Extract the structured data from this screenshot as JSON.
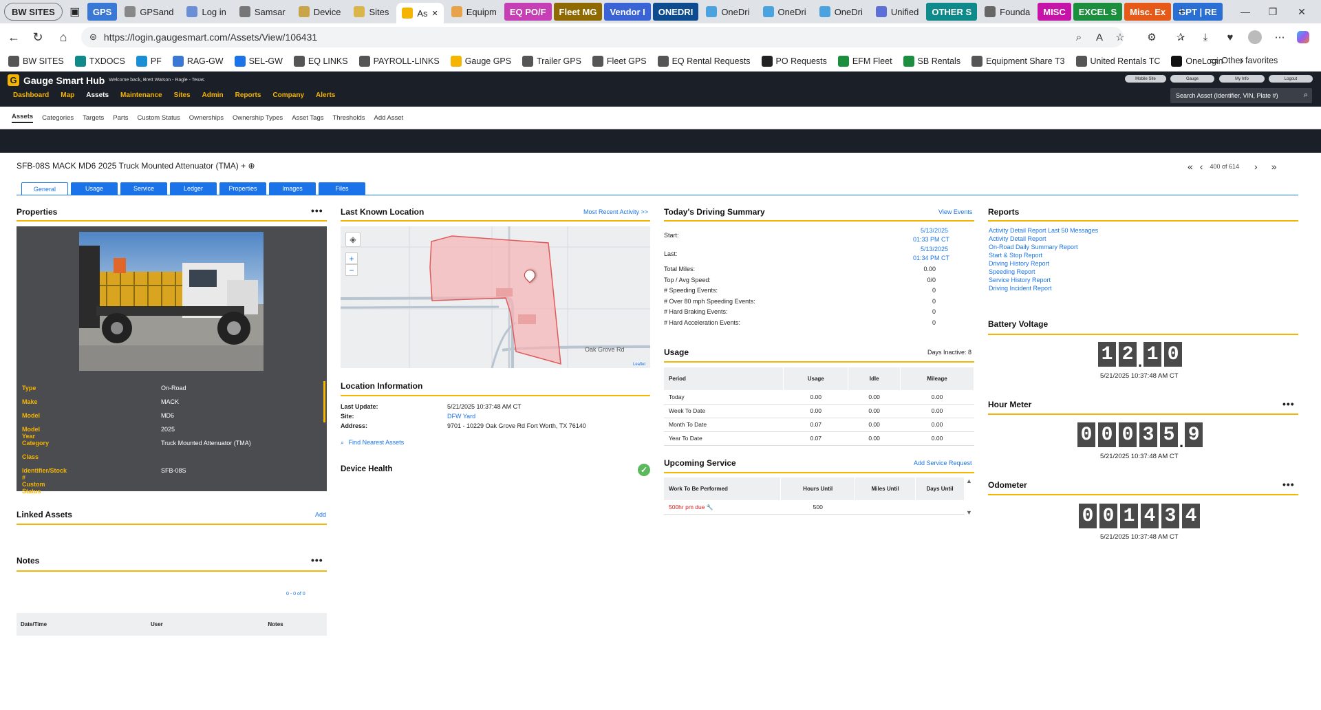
{
  "browser": {
    "tabs": [
      {
        "label": "BW SITES",
        "kind": "first",
        "color": ""
      },
      {
        "label": "GPS",
        "kind": "colored",
        "color": "#3a78d6"
      },
      {
        "label": "GPSand",
        "kind": "normal",
        "color": ""
      },
      {
        "label": "Log in",
        "kind": "normal",
        "color": ""
      },
      {
        "label": "Samsar",
        "kind": "normal",
        "color": ""
      },
      {
        "label": "Device",
        "kind": "normal",
        "color": ""
      },
      {
        "label": "Sites",
        "kind": "normal",
        "color": ""
      },
      {
        "label": "As",
        "kind": "active",
        "color": ""
      },
      {
        "label": "Equipm",
        "kind": "normal",
        "color": ""
      },
      {
        "label": "EQ PO/F",
        "kind": "colored",
        "color": "#c63fb4"
      },
      {
        "label": "Fleet MG",
        "kind": "colored",
        "color": "#8f6a00"
      },
      {
        "label": "Vendor I",
        "kind": "colored",
        "color": "#3a64d6"
      },
      {
        "label": "ONEDRI",
        "kind": "colored",
        "color": "#0d4c8f"
      },
      {
        "label": "OneDri",
        "kind": "normal",
        "color": ""
      },
      {
        "label": "OneDri",
        "kind": "normal",
        "color": ""
      },
      {
        "label": "OneDri",
        "kind": "normal",
        "color": ""
      },
      {
        "label": "Unified",
        "kind": "normal",
        "color": ""
      },
      {
        "label": "OTHER S",
        "kind": "colored",
        "color": "#0f8a8a"
      },
      {
        "label": "Founda",
        "kind": "normal",
        "color": ""
      },
      {
        "label": "MISC",
        "kind": "colored",
        "color": "#c614a8"
      },
      {
        "label": "EXCEL S",
        "kind": "colored",
        "color": "#1b8f3d"
      },
      {
        "label": "Misc. Ex",
        "kind": "colored",
        "color": "#e55a18"
      },
      {
        "label": "GPT | RE",
        "kind": "colored",
        "color": "#2a6fd4"
      }
    ],
    "url": "https://login.gaugesmart.com/Assets/View/106431",
    "bookmarks": [
      "BW SITES",
      "TXDOCS",
      "PF",
      "RAG-GW",
      "SEL-GW",
      "EQ LINKS",
      "PAYROLL-LINKS",
      "Gauge GPS",
      "Trailer GPS",
      "Fleet GPS",
      "EQ Rental Requests",
      "PO Requests",
      "EFM Fleet",
      "SB Rentals",
      "Equipment Share T3",
      "United Rentals TC",
      "OneLogin"
    ],
    "other_favorites": "Other favorites"
  },
  "app": {
    "brand": "Gauge Smart Hub",
    "welcome": "Welcome back, Brett Watson - Ragle - Texas",
    "nav": [
      "Dashboard",
      "Map",
      "Assets",
      "Maintenance",
      "Sites",
      "Admin",
      "Reports",
      "Company",
      "Alerts"
    ],
    "header_buttons": [
      "Mobile Site",
      "Gauge",
      "My Info",
      "Logout"
    ],
    "search_placeholder": "Search Asset (Identifier, VIN, Plate #)",
    "subnav": [
      "Assets",
      "Categories",
      "Targets",
      "Parts",
      "Custom Status",
      "Ownerships",
      "Ownership Types",
      "Asset Tags",
      "Thresholds",
      "Add Asset"
    ]
  },
  "asset": {
    "title": "SFB-08S MACK MD6 2025 Truck Mounted Attenuator (TMA) + ⊕",
    "pager": "400 of 614",
    "tabs": [
      "General",
      "Usage",
      "Service",
      "Ledger",
      "Properties",
      "Images",
      "Files"
    ]
  },
  "properties": {
    "heading": "Properties",
    "rows": [
      {
        "k": "Type",
        "v": "On-Road"
      },
      {
        "k": "Make",
        "v": "MACK"
      },
      {
        "k": "Model",
        "v": "MD6"
      },
      {
        "k": "Model Year",
        "v": "2025"
      },
      {
        "k": "Category",
        "v": "Truck Mounted Attenuator (TMA)"
      },
      {
        "k": "Class",
        "v": ""
      },
      {
        "k": "Identifier/Stock #",
        "v": "SFB-08S"
      },
      {
        "k": "Custom Status",
        "v": ""
      }
    ]
  },
  "linked_assets": {
    "heading": "Linked Assets",
    "add": "Add"
  },
  "notes": {
    "heading": "Notes",
    "count": "0 - 0 of 0",
    "columns": [
      "Date/Time",
      "User",
      "Notes"
    ]
  },
  "location": {
    "heading": "Last Known Location",
    "link": "Most Recent Activity >>",
    "road_label": "Oak Grove Rd",
    "attribution": "Leaflet",
    "info_heading": "Location Information",
    "last_update_label": "Last Update:",
    "last_update": "5/21/2025 10:37:48 AM CT",
    "site_label": "Site:",
    "site": "DFW Yard",
    "address_label": "Address:",
    "address": "9701 - 10229 Oak Grove Rd Fort Worth, TX 76140",
    "find_nearest": "Find Nearest Assets",
    "device_health": "Device Health"
  },
  "driving": {
    "heading": "Today's Driving Summary",
    "link": "View Events",
    "start_label": "Start:",
    "start_date": "5/13/2025",
    "start_time": "01:33 PM CT",
    "last_label": "Last:",
    "last_date": "5/13/2025",
    "last_time": "01:34 PM CT",
    "stats": [
      {
        "k": "Total Miles:",
        "v": "0.00"
      },
      {
        "k": "Top / Avg Speed:",
        "v": "0/0"
      },
      {
        "k": "# Speeding Events:",
        "v": "0"
      },
      {
        "k": "# Over 80 mph Speeding Events:",
        "v": "0"
      },
      {
        "k": "# Hard Braking Events:",
        "v": "0"
      },
      {
        "k": "# Hard Acceleration Events:",
        "v": "0"
      }
    ]
  },
  "usage": {
    "heading": "Usage",
    "days_inactive": "Days Inactive: 8",
    "columns": [
      "Period",
      "Usage",
      "Idle",
      "Mileage"
    ],
    "rows": [
      [
        "Today",
        "0.00",
        "0.00",
        "0.00"
      ],
      [
        "Week To Date",
        "0.00",
        "0.00",
        "0.00"
      ],
      [
        "Month To Date",
        "0.07",
        "0.00",
        "0.00"
      ],
      [
        "Year To Date",
        "0.07",
        "0.00",
        "0.00"
      ]
    ]
  },
  "upcoming": {
    "heading": "Upcoming Service",
    "link": "Add Service Request",
    "columns": [
      "Work To Be Performed",
      "Hours Until",
      "Miles Until",
      "Days Until"
    ],
    "rows": [
      [
        "500hr pm due",
        "500",
        "",
        ""
      ]
    ]
  },
  "reports": {
    "heading": "Reports",
    "links": [
      "Activity Detail Report Last 50 Messages",
      "Activity Detail Report",
      "On-Road Daily Summary Report",
      "Start & Stop Report",
      "Driving History Report",
      "Speeding Report",
      "Service History Report",
      "Driving Incident Report"
    ]
  },
  "battery": {
    "heading": "Battery Voltage",
    "digits": [
      "1",
      "2",
      ".",
      "1",
      "0"
    ],
    "time": "5/21/2025 10:37:48 AM CT"
  },
  "hourmeter": {
    "heading": "Hour Meter",
    "digits": [
      "0",
      "0",
      "0",
      "3",
      "5",
      ".",
      "9"
    ],
    "time": "5/21/2025 10:37:48 AM CT"
  },
  "odometer": {
    "heading": "Odometer",
    "digits": [
      "0",
      "0",
      "1",
      "4",
      "3",
      "4"
    ],
    "time": "5/21/2025 10:37:48 AM CT"
  },
  "colors": {
    "accent": "#f5b400",
    "link": "#1a73e8",
    "header": "#1b1f27",
    "alert": "#d11a1a",
    "geofence": "#e05a5a"
  },
  "icons": [
    "tab-actions-icon",
    "back-icon",
    "refresh-icon",
    "home-icon",
    "site-info-icon",
    "zoom-icon",
    "read-aloud-icon",
    "favorite-icon",
    "extensions-icon",
    "favorites-icon",
    "downloads-icon",
    "more-icon",
    "copilot-icon",
    "map-layers-icon",
    "zoom-in-icon",
    "zoom-out-icon",
    "map-pin-icon",
    "search-icon",
    "check-circle-icon",
    "wrench-icon",
    "scroll-up-icon",
    "scroll-down-icon",
    "first-page-icon",
    "prev-page-icon",
    "next-page-icon",
    "last-page-icon"
  ]
}
